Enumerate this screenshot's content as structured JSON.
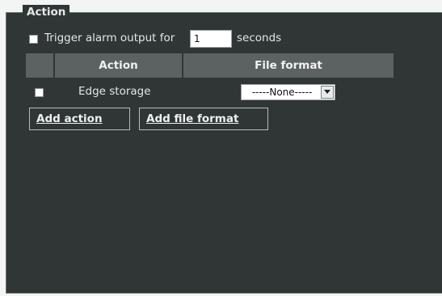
{
  "fieldset": {
    "legend": "Action"
  },
  "trigger": {
    "label_prefix": "Trigger alarm output for",
    "value": "1",
    "label_suffix": "seconds",
    "checked": false
  },
  "table": {
    "headers": [
      "Action",
      "File format"
    ],
    "rows": [
      {
        "checked": false,
        "action": "Edge storage",
        "file_format": "-----None-----"
      }
    ]
  },
  "buttons": {
    "add_action": "Add action",
    "add_file_format": "Add file format"
  },
  "colors": {
    "panel_bg": "#303536",
    "header_bg": "#5c6162",
    "page_bg": "#f3f4f4"
  }
}
